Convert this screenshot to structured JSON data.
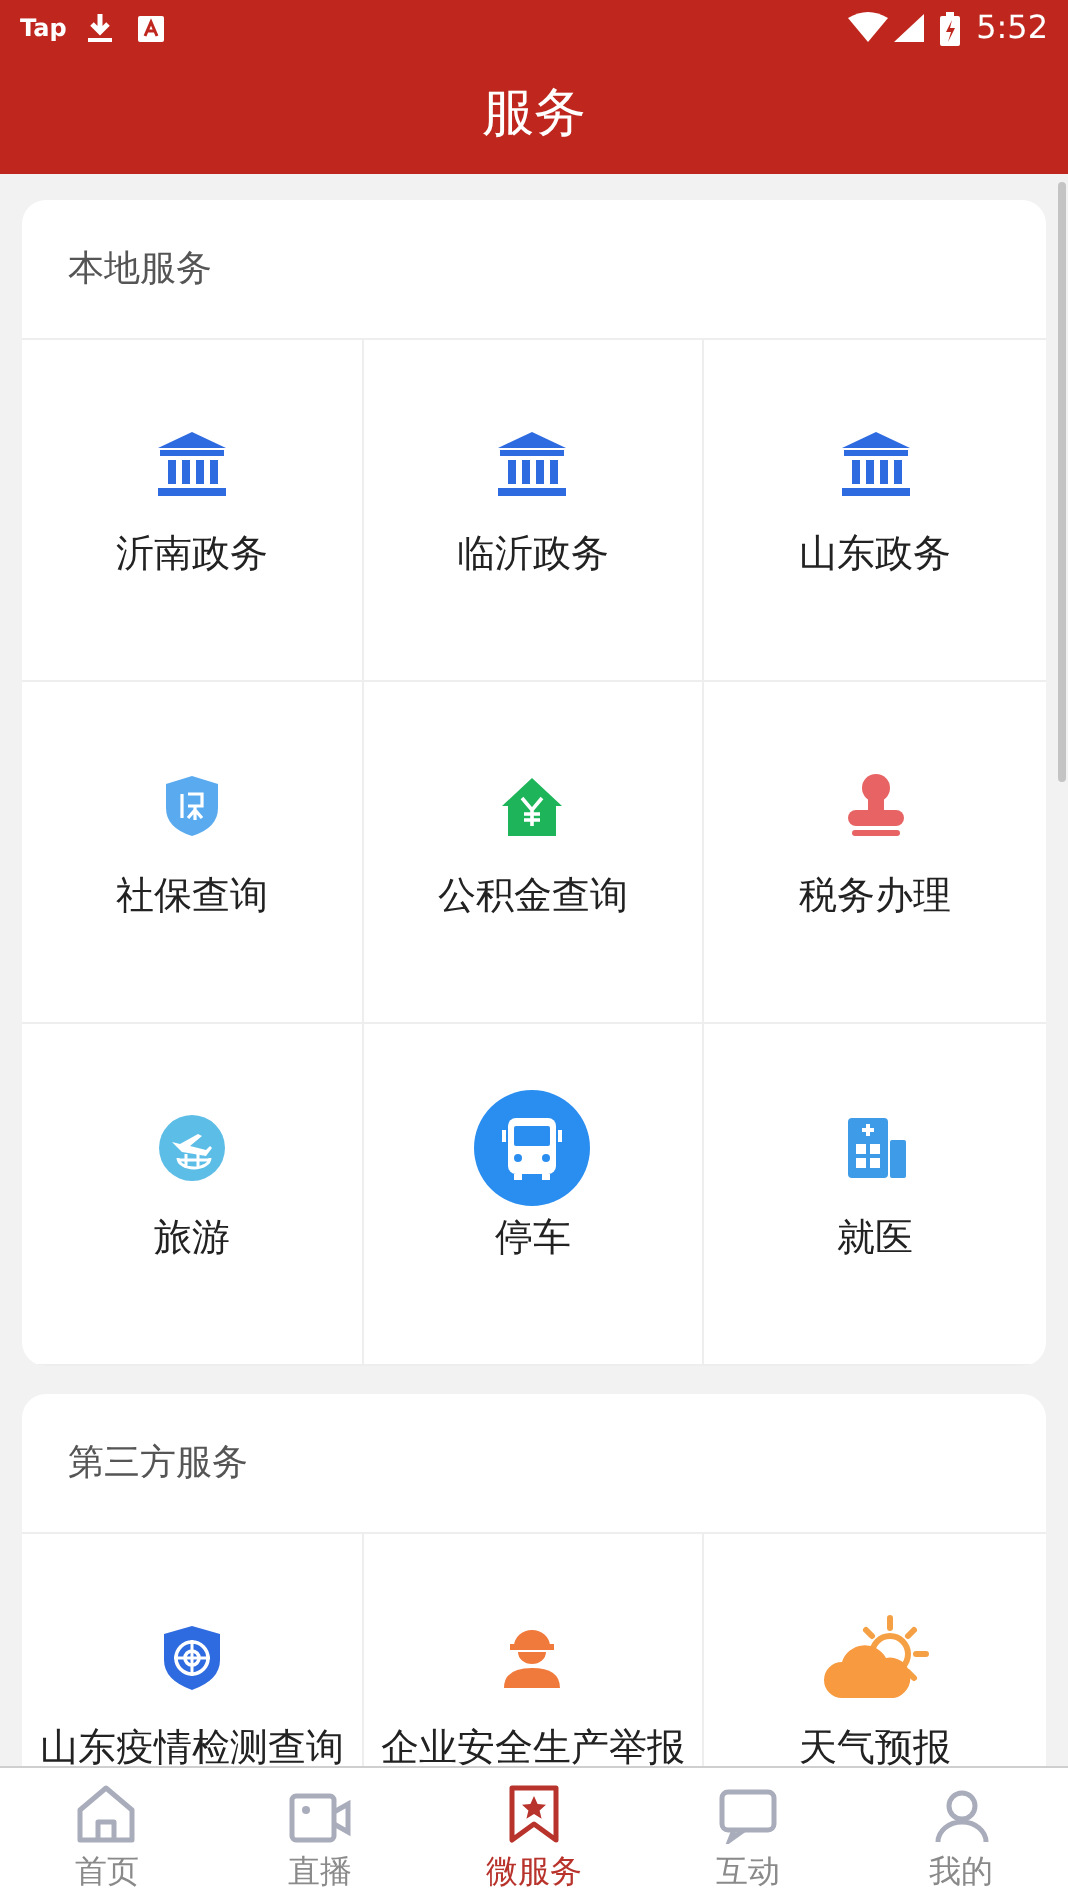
{
  "status_bar": {
    "app_label": "Tap",
    "time": "5:52"
  },
  "header": {
    "title": "服务"
  },
  "sections": [
    {
      "title": "本地服务",
      "items": [
        {
          "label": "沂南政务",
          "kind": "bank"
        },
        {
          "label": "临沂政务",
          "kind": "bank"
        },
        {
          "label": "山东政务",
          "kind": "bank"
        },
        {
          "label": "社保查询",
          "kind": "shield_bao"
        },
        {
          "label": "公积金查询",
          "kind": "house"
        },
        {
          "label": "税务办理",
          "kind": "stamp"
        },
        {
          "label": "旅游",
          "kind": "plane"
        },
        {
          "label": "停车",
          "kind": "bus"
        },
        {
          "label": "就医",
          "kind": "hospital"
        }
      ]
    },
    {
      "title": "第三方服务",
      "items": [
        {
          "label": "山东疫情检测查询",
          "kind": "shield_globe"
        },
        {
          "label": "企业安全生产举报",
          "kind": "worker"
        },
        {
          "label": "天气预报",
          "kind": "weather"
        }
      ]
    }
  ],
  "bottom_nav": [
    {
      "label": "首页",
      "kind": "home",
      "selected": false
    },
    {
      "label": "直播",
      "kind": "video",
      "selected": false
    },
    {
      "label": "微服务",
      "kind": "bookmark",
      "selected": true
    },
    {
      "label": "互动",
      "kind": "chat",
      "selected": false
    },
    {
      "label": "我的",
      "kind": "user",
      "selected": false
    }
  ]
}
